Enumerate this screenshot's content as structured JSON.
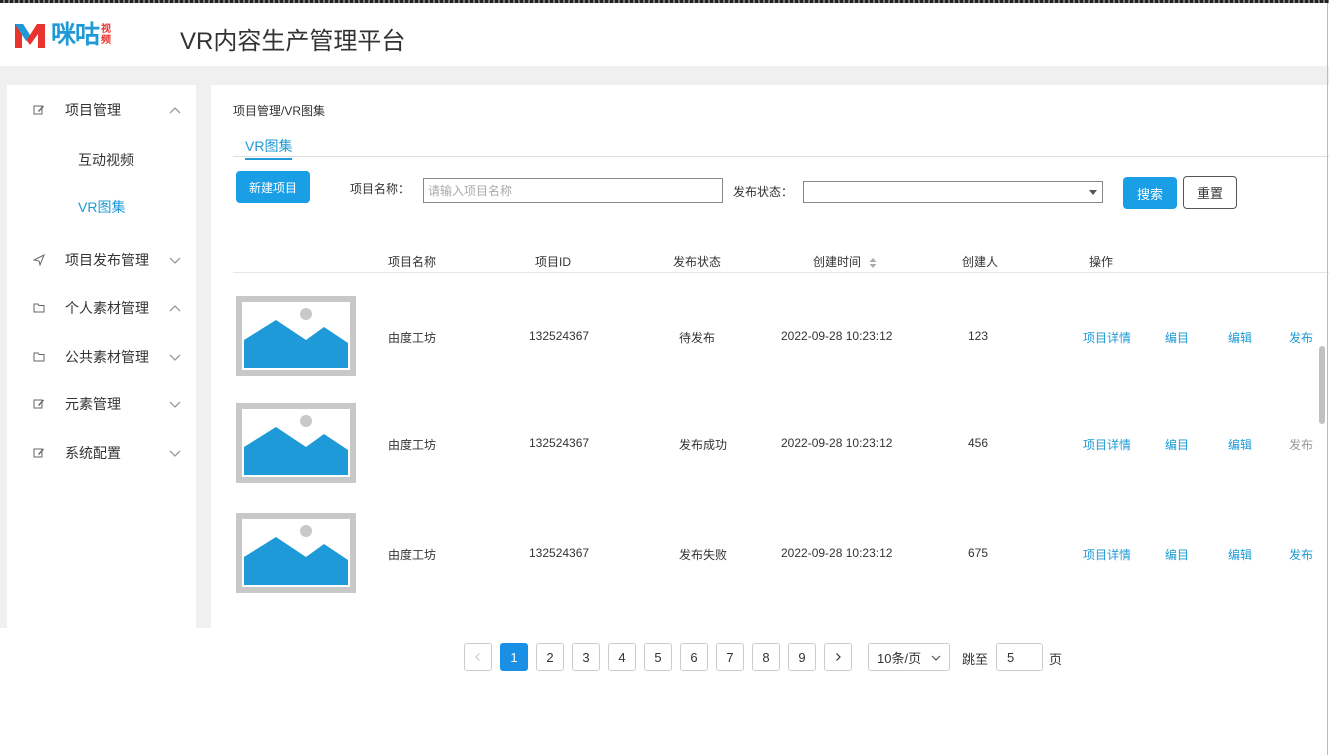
{
  "header": {
    "logo_text": "咪咕",
    "logo_sub_1": "视",
    "logo_sub_2": "频",
    "title": "VR内容生产管理平台"
  },
  "colors": {
    "accent": "#1f9ad6",
    "primary_button": "#1a9ee6",
    "brand_red": "#e8332f"
  },
  "sidebar": {
    "items": [
      {
        "label": "项目管理",
        "icon": "edit-icon",
        "expanded": true
      },
      {
        "label": "项目发布管理",
        "icon": "send-icon",
        "expanded": false
      },
      {
        "label": "个人素材管理",
        "icon": "folder-icon",
        "expanded": true
      },
      {
        "label": "公共素材管理",
        "icon": "folder-icon",
        "expanded": false
      },
      {
        "label": "元素管理",
        "icon": "edit-icon",
        "expanded": false
      },
      {
        "label": "系统配置",
        "icon": "edit-icon",
        "expanded": false
      }
    ],
    "sub_items": [
      {
        "label": "互动视频",
        "active": false
      },
      {
        "label": "VR图集",
        "active": true
      }
    ]
  },
  "main": {
    "breadcrumb": "项目管理/VR图集",
    "tab": "VR图集",
    "new_button": "新建项目",
    "filters": {
      "name_label": "项目名称：",
      "name_placeholder": "请输入项目名称",
      "name_value": "",
      "status_label": "发布状态：",
      "status_value": ""
    },
    "search_button": "搜索",
    "reset_button": "重置"
  },
  "table": {
    "columns": [
      "项目名称",
      "项目ID",
      "发布状态",
      "创建时间",
      "创建人",
      "操作"
    ],
    "rows": [
      {
        "name": "由度工坊",
        "id": "132524367",
        "status": "待发布",
        "created": "2022-09-28 10:23:12",
        "creator": "123",
        "ops": {
          "detail": "项目详情",
          "edit_list": "编目",
          "edit": "编辑",
          "publish": "发布"
        }
      },
      {
        "name": "由度工坊",
        "id": "132524367",
        "status": "发布成功",
        "created": "2022-09-28 10:23:12",
        "creator": "456",
        "ops": {
          "detail": "项目详情",
          "edit_list": "编目",
          "edit": "编辑",
          "publish": "发布"
        }
      },
      {
        "name": "由度工坊",
        "id": "132524367",
        "status": "发布失败",
        "created": "2022-09-28 10:23:12",
        "creator": "675",
        "ops": {
          "detail": "项目详情",
          "edit_list": "编目",
          "edit": "编辑",
          "publish": "发布"
        }
      }
    ]
  },
  "pagination": {
    "pages": [
      "1",
      "2",
      "3",
      "4",
      "5",
      "6",
      "7",
      "8",
      "9"
    ],
    "current": "1",
    "page_size": "10条/页",
    "jump_label": "跳至",
    "jump_value": "5",
    "page_suffix": "页"
  }
}
